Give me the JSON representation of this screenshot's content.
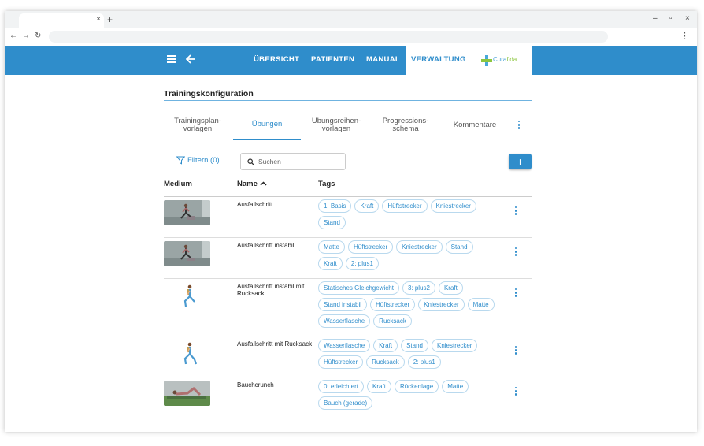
{
  "browser": {
    "tab_close": "×",
    "new_tab": "+",
    "minimize": "–",
    "maximize": "▫",
    "close": "×",
    "back": "←",
    "forward": "→",
    "reload": "↻",
    "menu": "⋮"
  },
  "nav": {
    "items": [
      "ÜBERSICHT",
      "PATIENTEN",
      "MANUAL",
      "VERWALTUNG"
    ],
    "active": "VERWALTUNG",
    "back_arrow": "🡐"
  },
  "logo": {
    "text_a": "Cura",
    "text_b": "fida"
  },
  "page": {
    "title": "Trainingskonfiguration"
  },
  "subtabs": [
    {
      "line1": "Trainingsplan-",
      "line2": "vorlagen"
    },
    {
      "line1": "Übungen",
      "line2": ""
    },
    {
      "line1": "Übungsreihen-",
      "line2": "vorlagen"
    },
    {
      "line1": "Progressions-",
      "line2": "schema"
    },
    {
      "line1": "Kommentare",
      "line2": ""
    }
  ],
  "toolbar": {
    "filter_label": "Filtern (0)",
    "search_placeholder": "Suchen",
    "add_label": "+"
  },
  "table": {
    "headers": {
      "medium": "Medium",
      "name": "Name",
      "tags": "Tags",
      "sort_indicator": "∧"
    },
    "rows": [
      {
        "name": "Ausfallschritt",
        "tags": [
          "1: Basis",
          "Kraft",
          "Hüftstrecker",
          "Kniestrecker",
          "Stand"
        ]
      },
      {
        "name": "Ausfallschritt instabil",
        "tags": [
          "Matte",
          "Hüftstrecker",
          "Kniestrecker",
          "Stand",
          "Kraft",
          "2: plus1"
        ]
      },
      {
        "name": "Ausfallschritt instabil mit Rucksack",
        "tags": [
          "Statisches Gleichgewicht",
          "3: plus2",
          "Kraft",
          "Stand instabil",
          "Hüftstrecker",
          "Kniestrecker",
          "Matte",
          "Wasserflasche",
          "Rucksack"
        ]
      },
      {
        "name": "Ausfallschritt mit Rucksack",
        "tags": [
          "Wasserflasche",
          "Kraft",
          "Stand",
          "Kniestrecker",
          "Hüftstrecker",
          "Rucksack",
          "2: plus1"
        ]
      },
      {
        "name": "Bauchcrunch",
        "tags": [
          "0: erleichtert",
          "Kraft",
          "Rückenlage",
          "Matte",
          "Bauch (gerade)"
        ]
      }
    ]
  },
  "colors": {
    "primary": "#2f8dcb",
    "chip_border": "#b9d9ee",
    "logo_green": "#8cc63f"
  }
}
